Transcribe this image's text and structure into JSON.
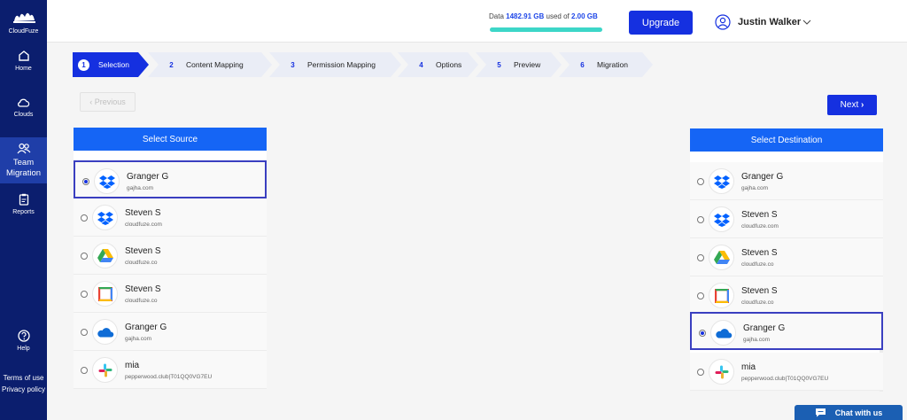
{
  "app": {
    "logo_text": "CloudFuze"
  },
  "sidebar": {
    "items": [
      {
        "label": "Home",
        "icon": "home-icon"
      },
      {
        "label": "Clouds",
        "icon": "cloud-icon"
      },
      {
        "label": "Team Migration",
        "icon": "team-icon"
      },
      {
        "label": "Reports",
        "icon": "reports-icon"
      },
      {
        "label": "Help",
        "icon": "help-icon"
      }
    ],
    "terms": "Terms of use",
    "privacy": "Privacy policy"
  },
  "header": {
    "storage_prefix": "Data",
    "storage_used": "1482.91 GB",
    "storage_mid": "used of",
    "storage_total": "2.00 GB",
    "upgrade_label": "Upgrade",
    "user_name": "Justin Walker"
  },
  "steps": [
    {
      "num": "1",
      "label": "Selection"
    },
    {
      "num": "2",
      "label": "Content Mapping"
    },
    {
      "num": "3",
      "label": "Permission Mapping"
    },
    {
      "num": "4",
      "label": "Options"
    },
    {
      "num": "5",
      "label": "Preview"
    },
    {
      "num": "6",
      "label": "Migration"
    }
  ],
  "nav": {
    "previous_label": "Previous",
    "next_label": "Next"
  },
  "source": {
    "title": "Select Source",
    "rows": [
      {
        "name": "Granger G",
        "domain": "gajha.com",
        "service": "dropbox",
        "selected": true
      },
      {
        "name": "Steven S",
        "domain": "cloudfuze.com",
        "service": "dropbox",
        "selected": false
      },
      {
        "name": "Steven S",
        "domain": "cloudfuze.co",
        "service": "google-drive",
        "selected": false
      },
      {
        "name": "Steven S",
        "domain": "cloudfuze.co",
        "service": "google-workspace",
        "selected": false
      },
      {
        "name": "Granger G",
        "domain": "gajha.com",
        "service": "onedrive",
        "selected": false
      },
      {
        "name": "mia",
        "domain": "pepperwood.club|T01QQ0VG7EU",
        "service": "slack",
        "selected": false
      }
    ]
  },
  "destination": {
    "title": "Select Destination",
    "rows": [
      {
        "name": "Granger G",
        "domain": "gajha.com",
        "service": "dropbox",
        "selected": false
      },
      {
        "name": "Steven S",
        "domain": "cloudfuze.com",
        "service": "dropbox",
        "selected": false
      },
      {
        "name": "Steven S",
        "domain": "cloudfuze.co",
        "service": "google-drive",
        "selected": false
      },
      {
        "name": "Steven S",
        "domain": "cloudfuze.co",
        "service": "google-workspace",
        "selected": false
      },
      {
        "name": "Granger G",
        "domain": "gajha.com",
        "service": "onedrive",
        "selected": true
      },
      {
        "name": "mia",
        "domain": "pepperwood.club|T01QQ0VG7EU",
        "service": "slack",
        "selected": false
      }
    ]
  },
  "chat": {
    "label": "Chat with us"
  },
  "colors": {
    "sidebar": "#0b1e6e",
    "accent": "#1530e0",
    "panel_head": "#1565f5",
    "storage_bar": "#3dd6c8"
  }
}
